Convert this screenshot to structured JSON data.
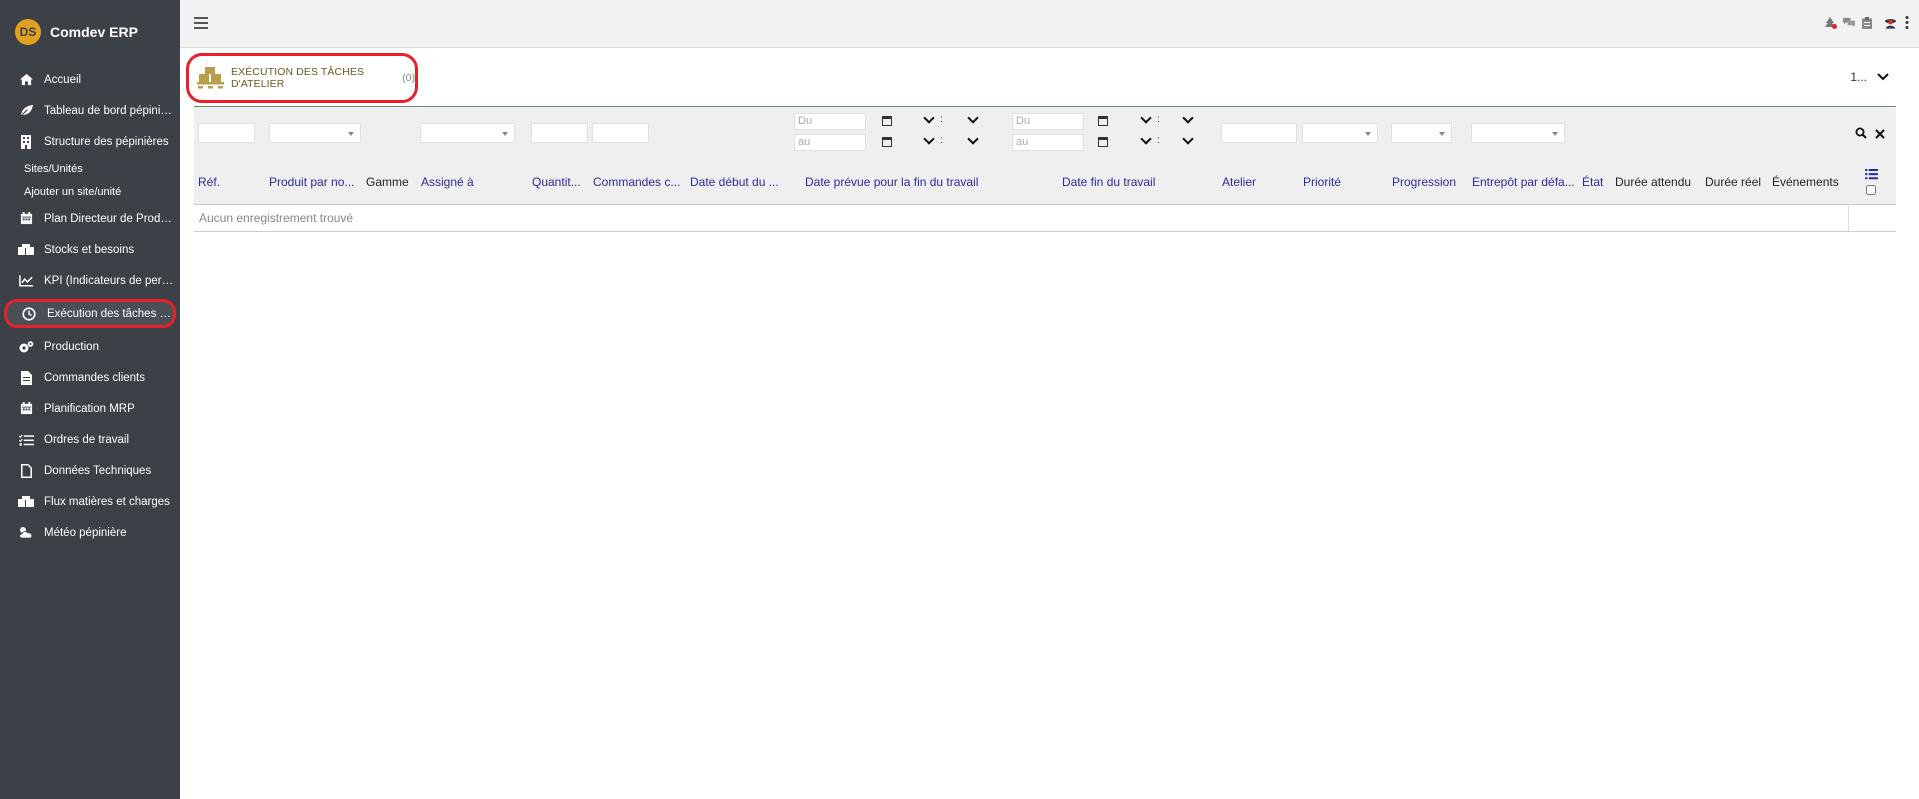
{
  "app": {
    "name": "Comdev ERP",
    "logo_text": "DS"
  },
  "sidebar": {
    "items": [
      {
        "label": "Accueil",
        "icon": "home-icon"
      },
      {
        "label": "Tableau de bord pépinière",
        "icon": "leaf-icon"
      },
      {
        "label": "Structure des pépinières",
        "icon": "building-icon"
      }
    ],
    "sub_items": [
      {
        "label": "Sites/Unités"
      },
      {
        "label": "Ajouter un site/unité"
      }
    ],
    "items_after": [
      {
        "label": "Plan Directeur de Produ...",
        "icon": "calendar-icon"
      },
      {
        "label": "Stocks et besoins",
        "icon": "boxes-icon"
      },
      {
        "label": "KPI (Indicateurs de perf...",
        "icon": "chart-line-icon"
      },
      {
        "label": "Exécution des tâches d'...",
        "icon": "clock-icon",
        "active": true
      },
      {
        "label": "Production",
        "icon": "cogs-icon"
      },
      {
        "label": "Commandes clients",
        "icon": "file-icon"
      },
      {
        "label": "Planification MRP",
        "icon": "calendar-icon"
      },
      {
        "label": "Ordres de travail",
        "icon": "list-check-icon"
      },
      {
        "label": "Données Techniques",
        "icon": "file-outline-icon"
      },
      {
        "label": "Flux matières et charges",
        "icon": "boxes-icon"
      },
      {
        "label": "Météo pépinière",
        "icon": "cloud-sun-icon"
      }
    ]
  },
  "page": {
    "title": "EXÉCUTION DES TÂCHES D'ATELIER",
    "count": "(0)",
    "pager": "1..."
  },
  "filters": {
    "date_from": "Du",
    "date_to": "au"
  },
  "table": {
    "columns": [
      "Réf.",
      "Produit par no...",
      "Gamme",
      "Assigné à",
      "Quantit...",
      "Commandes c...",
      "Date début du ...",
      "Date prévue pour la fin du travail",
      "Date fin du travail",
      "Atelier",
      "Priorité",
      "Progression",
      "Entrepôt par défa...",
      "État",
      "Durée attendu",
      "Durée réel",
      "Événements"
    ],
    "empty_message": "Aucun enregistrement trouvé"
  },
  "colors": {
    "sidebar_bg": "#3c4148",
    "highlight": "#e8202a",
    "link": "#2a2aa0",
    "title": "#6b5a1e"
  }
}
